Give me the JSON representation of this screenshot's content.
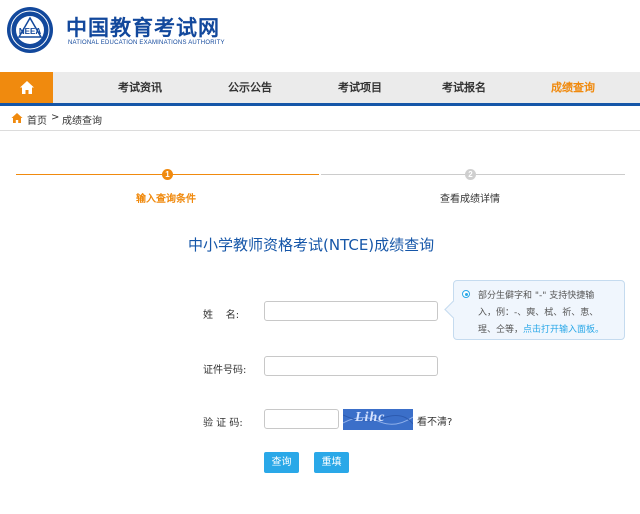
{
  "header": {
    "logo_cn": "中国教育考试网",
    "logo_en": "NATIONAL EDUCATION EXAMINATIONS AUTHORITY",
    "emblem_text": "NEEA"
  },
  "nav": {
    "home_icon": "home-icon",
    "items": [
      {
        "label": "考试资讯"
      },
      {
        "label": "公示公告"
      },
      {
        "label": "考试项目"
      },
      {
        "label": "考试报名"
      },
      {
        "label": "成绩查询",
        "active": true
      }
    ],
    "accent_color": "#f08a0e",
    "bar_color": "#1556a8"
  },
  "breadcrumb": {
    "home": "首页",
    "separator": ">",
    "current": "成绩查询"
  },
  "steps": [
    {
      "number": "1",
      "label": "输入查询条件",
      "active": true
    },
    {
      "number": "2",
      "label": "查看成绩详情",
      "active": false
    }
  ],
  "form": {
    "title": "中小学教师资格考试(NTCE)成绩查询",
    "name_label": "姓    名:",
    "name_value": "",
    "id_label": "证件号码:",
    "id_value": "",
    "captcha_label": "验 证 码:",
    "captcha_value": "",
    "captcha_image_text": "Lihc",
    "captcha_refresh": "看不清?",
    "submit_label": "查询",
    "reset_label": "重填"
  },
  "tooltip": {
    "line1": "部分生僻字和 \"-\" 支持快捷输",
    "line2": "入，例：-、奭、栻、祈、恵、",
    "line3_prefix": "瑆、仝等，",
    "line3_link": "点击打开输入面板。"
  }
}
